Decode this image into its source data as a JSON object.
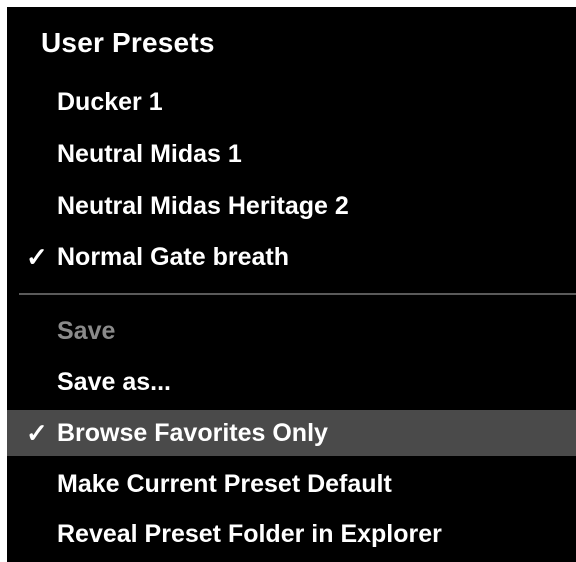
{
  "menu": {
    "title": "User Presets",
    "check_glyph": "✓",
    "presets": [
      {
        "label": "Ducker 1",
        "checked": false
      },
      {
        "label": "Neutral Midas 1",
        "checked": false
      },
      {
        "label": "Neutral Midas Heritage 2",
        "checked": false
      },
      {
        "label": "Normal Gate breath",
        "checked": true
      }
    ],
    "actions": [
      {
        "label": "Save",
        "disabled": true
      },
      {
        "label": "Save as..."
      },
      {
        "label": "Browse Favorites Only",
        "checked": true,
        "highlighted": true
      },
      {
        "label": "Make Current Preset Default"
      },
      {
        "label": "Reveal Preset Folder in Explorer"
      }
    ]
  },
  "colors": {
    "background": "#000000",
    "text": "#ffffff",
    "disabled_text": "#8a8a8a",
    "highlight": "#4a4a4a",
    "separator": "#5a5a5a"
  }
}
